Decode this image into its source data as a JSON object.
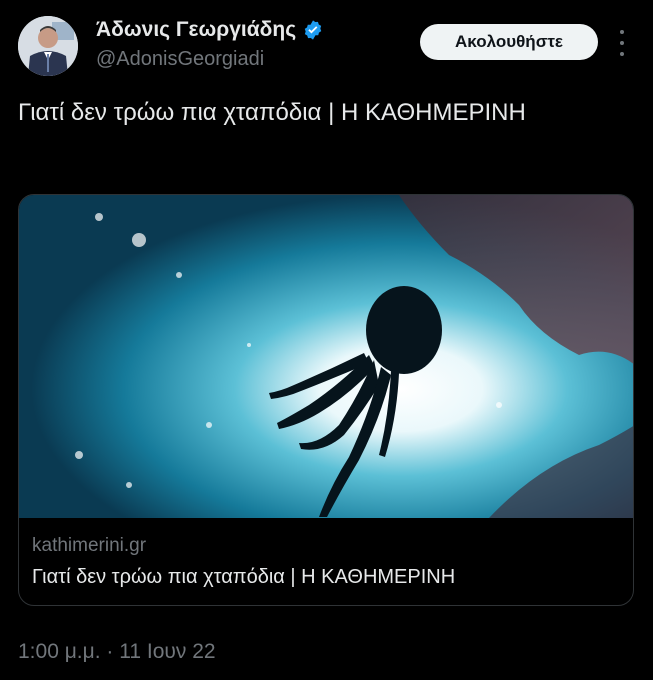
{
  "author": {
    "name": "Άδωνις Γεωργιάδης",
    "handle": "@AdonisGeorgiadi",
    "verified_color": "#1d9bf0"
  },
  "actions": {
    "follow_label": "Ακολουθήστε",
    "more_icon": "more-vertical-icon"
  },
  "tweet": {
    "text": "Γιατί δεν τρώω πια χταπόδια | Η ΚΑΘΗΜΕΡΙΝΗ",
    "timestamp": "1:00 μ.μ. · 11 Ιουν 22"
  },
  "card": {
    "domain": "kathimerini.gr",
    "title": "Γιατί δεν τρώω πια χταπόδια | Η ΚΑΘΗΜΕΡΙΝΗ"
  },
  "colors": {
    "background": "#000000",
    "text_primary": "#e7e9ea",
    "text_secondary": "#71767b",
    "accent": "#1d9bf0"
  }
}
